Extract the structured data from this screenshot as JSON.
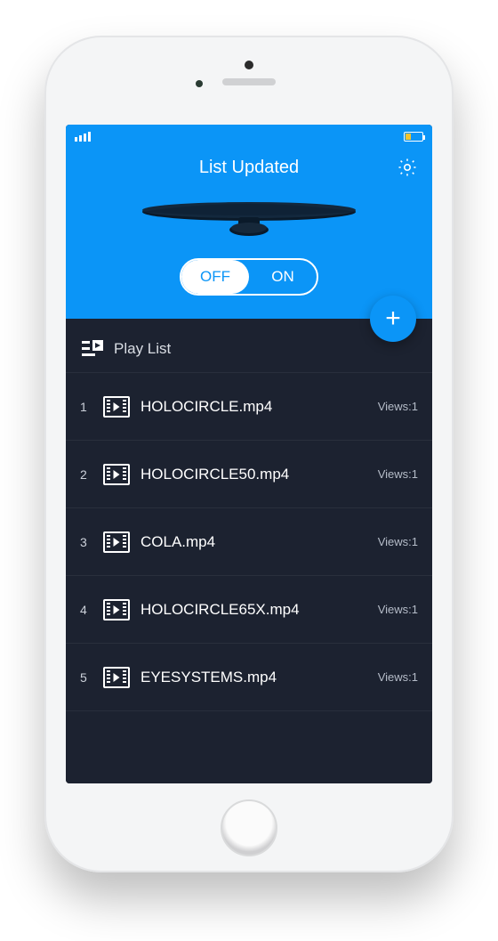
{
  "header": {
    "title": "List Updated",
    "toggle": {
      "off": "OFF",
      "on": "ON",
      "state": "off"
    }
  },
  "fab": {
    "label": "+"
  },
  "playlist": {
    "header": "Play List",
    "views_prefix": "Views:",
    "items": [
      {
        "index": "1",
        "name": "HOLOCIRCLE.mp4",
        "views": "1"
      },
      {
        "index": "2",
        "name": "HOLOCIRCLE50.mp4",
        "views": "1"
      },
      {
        "index": "3",
        "name": "COLA.mp4",
        "views": "1"
      },
      {
        "index": "4",
        "name": "HOLOCIRCLE65X.mp4",
        "views": "1"
      },
      {
        "index": "5",
        "name": "EYESYSTEMS.mp4",
        "views": "1"
      }
    ]
  },
  "colors": {
    "accent": "#0b95f7",
    "bg_dark": "#1c2230"
  }
}
